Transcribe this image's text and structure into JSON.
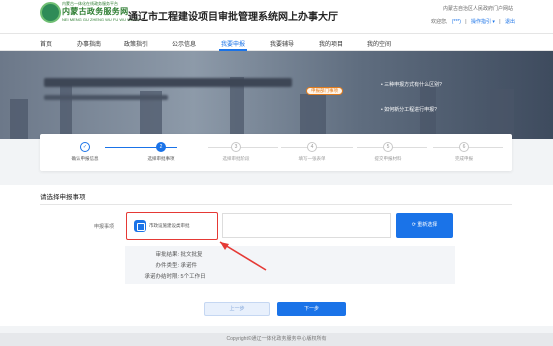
{
  "header": {
    "logo_top": "内蒙古一体化在线政务服务平台",
    "logo_main": "内蒙古政务服务网",
    "logo_sub": "NEI MENG GU ZHENG WU FU WU WANG",
    "title": "通辽市工程建设项目审批管理系统网上办事大厅",
    "portal_link": "内蒙古自治区人民政府门户网站",
    "welcome": "欢迎您,",
    "username": "(***)",
    "guide": "操作指引 ▾",
    "logout": "退出"
  },
  "nav": {
    "items": [
      "首页",
      "办事指南",
      "政策指引",
      "公示信息",
      "我要申报",
      "我要辅导",
      "我的项目",
      "我的空间"
    ],
    "active_index": 4
  },
  "banner": {
    "badge": "申报部门事项",
    "faq": [
      "三种申报方式有什么区别?",
      "如何新分工程进行申报?"
    ]
  },
  "steps": [
    {
      "label": "确认申报信息",
      "state": "done",
      "symbol": "✓"
    },
    {
      "label": "选择审批事项",
      "state": "active",
      "symbol": "2"
    },
    {
      "label": "选择审批阶段",
      "state": "todo",
      "symbol": "3"
    },
    {
      "label": "填写一张表单",
      "state": "todo",
      "symbol": "4"
    },
    {
      "label": "提交申报材料",
      "state": "todo",
      "symbol": "5"
    },
    {
      "label": "完成申报",
      "state": "todo",
      "symbol": "6"
    }
  ],
  "form": {
    "section_title": "请选择申报事项",
    "field_label": "申报事项",
    "selected_item": "市政设施建设类审批",
    "reselect_label": "重新选择",
    "reselect_icon": "refresh-icon",
    "details": [
      {
        "key": "审批结果:",
        "value": "批文批复"
      },
      {
        "key": "办件类型:",
        "value": "承诺件"
      },
      {
        "key": "承诺办结时限:",
        "value": "5个工作日"
      }
    ],
    "prev_label": "上一步",
    "next_label": "下一步"
  },
  "footer": {
    "copyright": "Copyright©通辽一体化政务服务中心版权所有"
  },
  "colors": {
    "accent": "#1a73e8",
    "highlight_border": "#e53935",
    "badge": "#e07b1c"
  }
}
